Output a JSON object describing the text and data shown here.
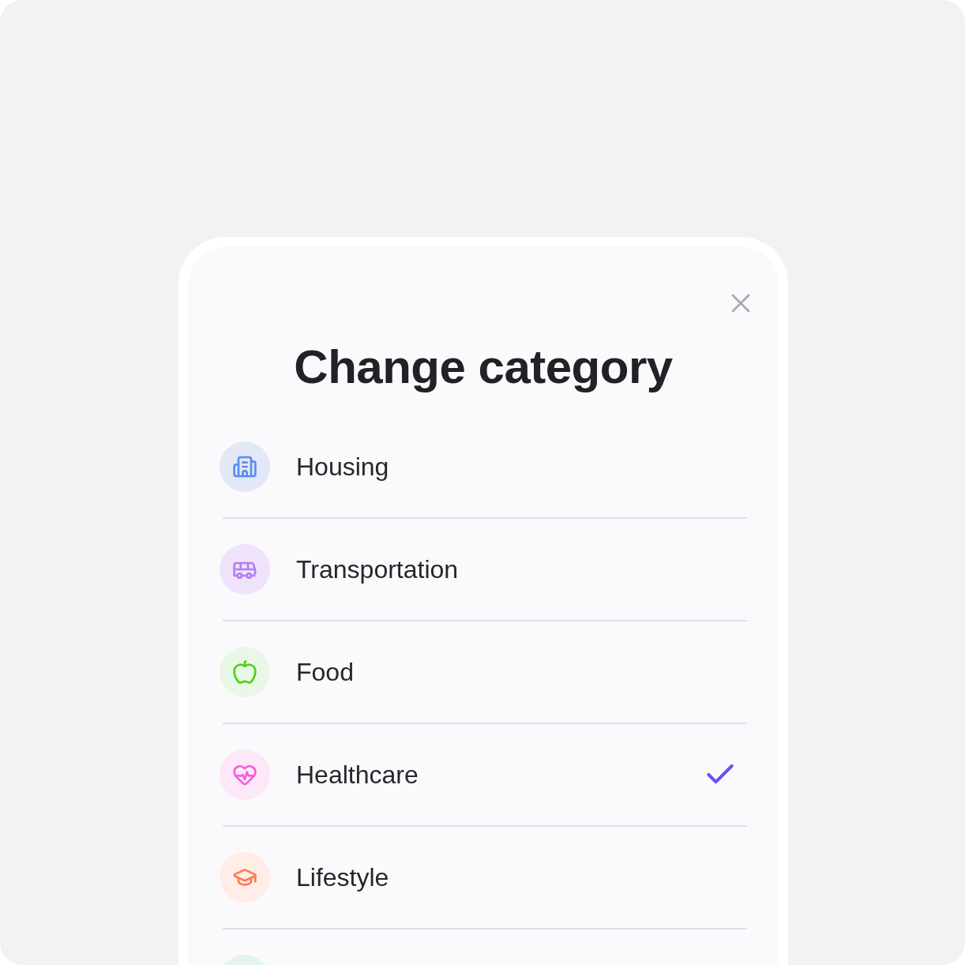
{
  "dialog": {
    "title": "Change category"
  },
  "categories": [
    {
      "label": "Housing",
      "color": "#e2e8f6",
      "selected": false
    },
    {
      "label": "Transportation",
      "color": "#eee3fb",
      "selected": false
    },
    {
      "label": "Food",
      "color": "#e9f8e6",
      "selected": false
    },
    {
      "label": "Healthcare",
      "color": "#fde8fa",
      "selected": true
    },
    {
      "label": "Lifestyle",
      "color": "#ffede8",
      "selected": false
    },
    {
      "color": "#e3f5ec"
    }
  ]
}
